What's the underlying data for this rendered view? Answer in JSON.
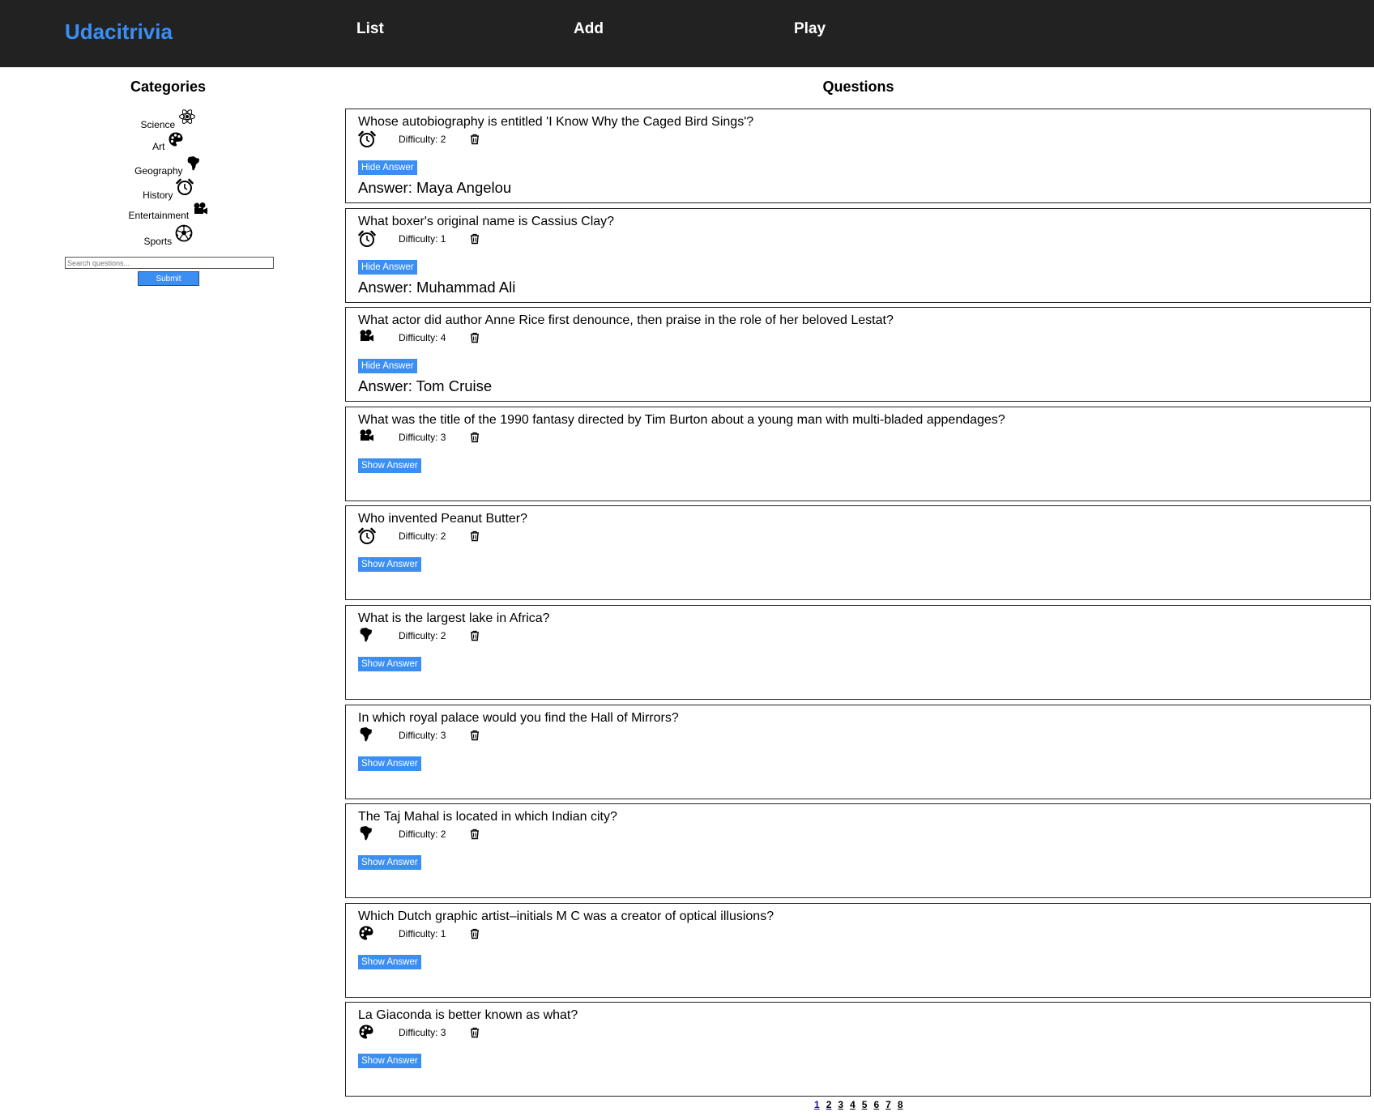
{
  "header": {
    "brand": "Udacitrivia",
    "nav": [
      {
        "label": "List"
      },
      {
        "label": "Add"
      },
      {
        "label": "Play"
      }
    ]
  },
  "sidebar": {
    "title": "Categories",
    "categories": [
      {
        "label": "Science",
        "icon": "science-icon"
      },
      {
        "label": "Art",
        "icon": "art-icon"
      },
      {
        "label": "Geography",
        "icon": "geography-icon"
      },
      {
        "label": "History",
        "icon": "history-icon"
      },
      {
        "label": "Entertainment",
        "icon": "entertainment-icon"
      },
      {
        "label": "Sports",
        "icon": "sports-icon"
      }
    ],
    "search": {
      "placeholder": "Search questions...",
      "value": ""
    },
    "submit_label": "Submit"
  },
  "main": {
    "title": "Questions",
    "questions": [
      {
        "text": "Whose autobiography is entitled 'I Know Why the Caged Bird Sings'?",
        "category_icon": "history-icon",
        "difficulty": "Difficulty: 2",
        "button": "Hide Answer",
        "answer": "Answer: Maya Angelou"
      },
      {
        "text": "What boxer's original name is Cassius Clay?",
        "category_icon": "history-icon",
        "difficulty": "Difficulty: 1",
        "button": "Hide Answer",
        "answer": "Answer: Muhammad Ali"
      },
      {
        "text": "What actor did author Anne Rice first denounce, then praise in the role of her beloved Lestat?",
        "category_icon": "entertainment-icon",
        "difficulty": "Difficulty: 4",
        "button": "Hide Answer",
        "answer": "Answer: Tom Cruise"
      },
      {
        "text": "What was the title of the 1990 fantasy directed by Tim Burton about a young man with multi-bladed appendages?",
        "category_icon": "entertainment-icon",
        "difficulty": "Difficulty: 3",
        "button": "Show Answer",
        "answer": ""
      },
      {
        "text": "Who invented Peanut Butter?",
        "category_icon": "history-icon",
        "difficulty": "Difficulty: 2",
        "button": "Show Answer",
        "answer": ""
      },
      {
        "text": "What is the largest lake in Africa?",
        "category_icon": "geography-icon",
        "difficulty": "Difficulty: 2",
        "button": "Show Answer",
        "answer": ""
      },
      {
        "text": "In which royal palace would you find the Hall of Mirrors?",
        "category_icon": "geography-icon",
        "difficulty": "Difficulty: 3",
        "button": "Show Answer",
        "answer": ""
      },
      {
        "text": "The Taj Mahal is located in which Indian city?",
        "category_icon": "geography-icon",
        "difficulty": "Difficulty: 2",
        "button": "Show Answer",
        "answer": ""
      },
      {
        "text": "Which Dutch graphic artist–initials M C was a creator of optical illusions?",
        "category_icon": "art-icon",
        "difficulty": "Difficulty: 1",
        "button": "Show Answer",
        "answer": ""
      },
      {
        "text": "La Giaconda is better known as what?",
        "category_icon": "art-icon",
        "difficulty": "Difficulty: 3",
        "button": "Show Answer",
        "answer": ""
      }
    ]
  },
  "pagination": {
    "pages": [
      "1",
      "2",
      "3",
      "4",
      "5",
      "6",
      "7",
      "8"
    ],
    "current": "1"
  },
  "colors": {
    "header_bg": "#222222",
    "brand": "#3b8ff2",
    "button_bg": "#3b8ff2",
    "active_page": "#1a0dab"
  }
}
